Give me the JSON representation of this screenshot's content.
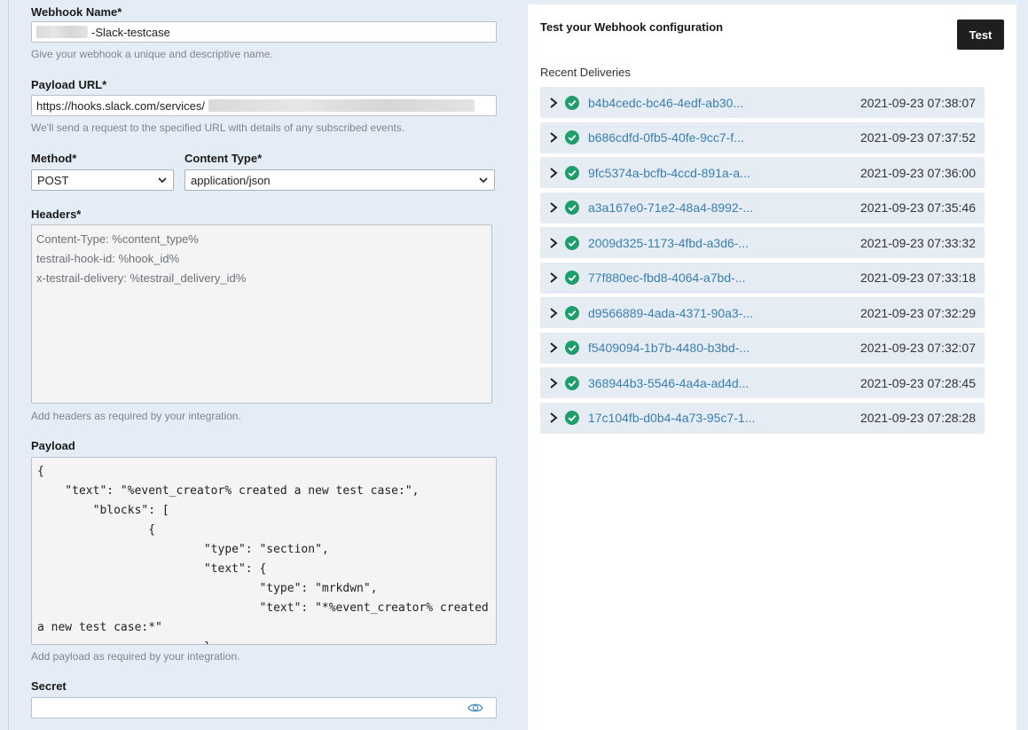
{
  "form": {
    "webhook_name": {
      "label": "Webhook Name*",
      "value": "-Slack-testcase",
      "help": "Give your webhook a unique and descriptive name."
    },
    "payload_url": {
      "label": "Payload URL*",
      "value": "https://hooks.slack.com/services/",
      "help": "We'll send a request to the specified URL with details of any subscribed events."
    },
    "method": {
      "label": "Method*",
      "value": "POST"
    },
    "content_type": {
      "label": "Content Type*",
      "value": "application/json"
    },
    "headers": {
      "label": "Headers*",
      "lines": [
        "Content-Type: %content_type%",
        "testrail-hook-id: %hook_id%",
        "x-testrail-delivery: %testrail_delivery_id%"
      ],
      "help": "Add headers as required by your integration."
    },
    "payload": {
      "label": "Payload",
      "text": "{\n    \"text\": \"%event_creator% created a new test case:\",\n        \"blocks\": [\n                {\n                        \"type\": \"section\",\n                        \"text\": {\n                                \"type\": \"mrkdwn\",\n                                \"text\": \"*%event_creator% created\na new test case:*\"\n                        },",
      "help": "Add payload as required by your integration."
    },
    "secret": {
      "label": "Secret",
      "value": ""
    }
  },
  "panel": {
    "title": "Test your Webhook configuration",
    "test_button": "Test",
    "recent_label": "Recent Deliveries",
    "deliveries": [
      {
        "id": "b4b4cedc-bc46-4edf-ab30...",
        "time": "2021-09-23 07:38:07"
      },
      {
        "id": "b686cdfd-0fb5-40fe-9cc7-f...",
        "time": "2021-09-23 07:37:52"
      },
      {
        "id": "9fc5374a-bcfb-4ccd-891a-a...",
        "time": "2021-09-23 07:36:00"
      },
      {
        "id": "a3a167e0-71e2-48a4-8992-...",
        "time": "2021-09-23 07:35:46"
      },
      {
        "id": "2009d325-1173-4fbd-a3d6-...",
        "time": "2021-09-23 07:33:32"
      },
      {
        "id": "77f880ec-fbd8-4064-a7bd-...",
        "time": "2021-09-23 07:33:18"
      },
      {
        "id": "d9566889-4ada-4371-90a3-...",
        "time": "2021-09-23 07:32:29"
      },
      {
        "id": "f5409094-1b7b-4480-b3bd-...",
        "time": "2021-09-23 07:32:07"
      },
      {
        "id": "368944b3-5546-4a4a-ad4d...",
        "time": "2021-09-23 07:28:45"
      },
      {
        "id": "17c104fb-d0b4-4a73-95c7-1...",
        "time": "2021-09-23 07:28:28"
      }
    ],
    "status_color": "#1e9e6a",
    "link_color": "#3a7fb0"
  },
  "icons": {
    "expand": "chevron-right-icon",
    "status": "check-circle-icon",
    "reveal": "eye-icon",
    "dropdown": "chevron-down-icon"
  }
}
